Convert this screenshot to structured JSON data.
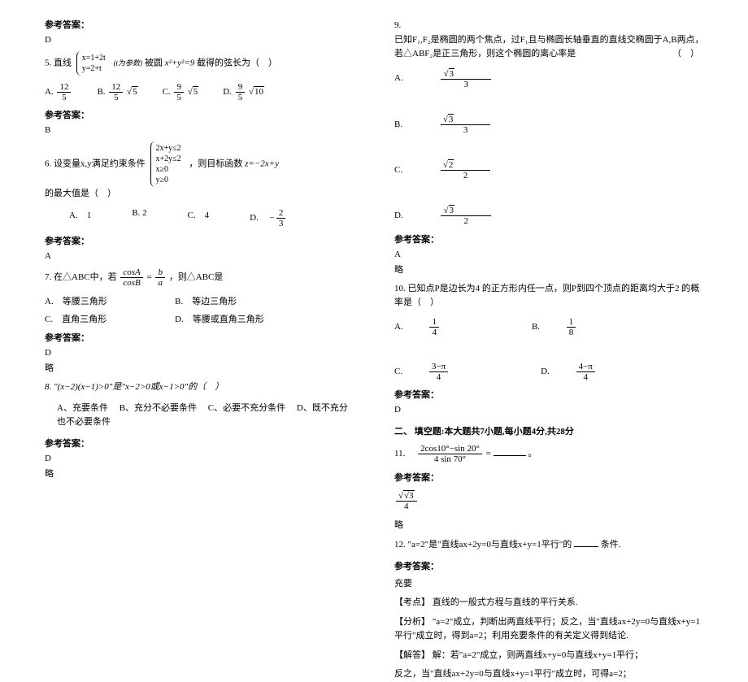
{
  "answerLabel": "参考答案：",
  "briefLabel": "略",
  "leftCol": {
    "ans4": "D",
    "q5": {
      "prefix": "5. 直线",
      "brace1": "x=1+2t",
      "brace2": "y=2+t",
      "braceSuffix": "(t为参数)",
      "mid": "被圆",
      "eq": "x²+y²=9",
      "suffix": "截得的弦长为（　）",
      "optA_label": "A.",
      "optA": "12/5",
      "optB_label": "B.",
      "optB": "12/5 √5",
      "optC_label": "C.",
      "optC": "9/5 √5",
      "optD_label": "D.",
      "optD": "9/5 √10"
    },
    "ans5": "B",
    "q6": {
      "prefix": "6. 设变量x,y满足约束条件",
      "b1": "2x+y≤2",
      "b2": "x+2y≤2",
      "b3": "x≥0",
      "b4": "y≥0",
      "mid": "，则目标函数",
      "func": "z=−2x+y",
      "suffix": "的最大值是（　）",
      "optA": "A.　1",
      "optB": "B. 2",
      "optC": "C.　4",
      "optD_label": "D.　",
      "optD_num": "2",
      "optD_den": "3",
      "optD_pre": "−"
    },
    "ans6": "A",
    "q7": {
      "line1_prefix": "7. 在△ABC中，若",
      "frac_num": "cosA",
      "frac_den": "cosB",
      "eq": " = ",
      "frac2_num": "b",
      "frac2_den": "a",
      "line1_suffix": "，则△ABC是",
      "optA": "A.　等腰三角形",
      "optB": "B.　等边三角形",
      "optC": "C.　直角三角形",
      "optD": "D.　等腰或直角三角形"
    },
    "ans7": "D",
    "q8": {
      "text": "8. \"(x−2)(x−1)>0\"是\"x−2>0或x−1>0\"的（　）",
      "optA": "A、充要条件",
      "optB": "B、充分不必要条件",
      "optC": "C、必要不充分条件",
      "optD": "D、既不充分也不必要条件"
    },
    "ans8": "D"
  },
  "rightCol": {
    "q9": {
      "num": "9.",
      "text": "已知F₁,F₂是椭圆的两个焦点，过F₁且与椭圆长轴垂直的直线交椭圆于A,B两点，若△ABF₂是正三角形，则这个椭圆的离心率是",
      "paren": "（　）",
      "optA_label": "A.",
      "optA_num": "√3",
      "optA_den": "3",
      "optB_label": "B.",
      "optB_num": "√3",
      "optB_den": "3",
      "optC_label": "C.",
      "optC_num": "√2",
      "optC_den": "2",
      "optD_label": "D.",
      "optD_num": "√3",
      "optD_den": "2"
    },
    "ans9": "A",
    "q10": {
      "text": "10. 已知点P是边长为4 的正方形内任一点，则P到四个顶点的距离均大于2 的概率是（　）",
      "optA_label": "A.",
      "optA_num": "1",
      "optA_den": "4",
      "optB_label": "B.",
      "optB_num": "1",
      "optB_den": "8",
      "optC_label": "C.",
      "optC_num": "3−π",
      "optC_den": "4",
      "optD_label": "D.",
      "optD_num": "4−π",
      "optD_den": "4"
    },
    "ans10": "D",
    "sectionTitle": "二、 填空题:本大题共7小题,每小题4分,共28分",
    "q11": {
      "prefix": "11.　",
      "num": "2cos10°−sin 20°",
      "den": "4 sin 70°",
      "suffix": " =",
      "blank": "________",
      "period": "。"
    },
    "ans11_num": "√3",
    "ans11_den": "4",
    "q12": {
      "text": "12. \"a=2\"是\"直线ax+2y=0与直线x+y=1平行\"的",
      "suffix": "条件."
    },
    "ans12": "充要",
    "analysis": {
      "l1_label": "【考点】",
      "l1": "直线的一般式方程与直线的平行关系.",
      "l2_label": "【分析】",
      "l2": "\"a=2\"成立，判断出两直线平行；反之，当\"直线ax+2y=0与直线x+y=1平行\"成立时，得到a=2；利用充要条件的有关定义得到结论.",
      "l3_label": "【解答】",
      "l3": "解：若\"a=2\"成立，则两直线x+y=0与直线x+y=1平行；",
      "l4": "反之，当\"直线ax+2y=0与直线x+y=1平行\"成立时，可得a=2；"
    }
  }
}
